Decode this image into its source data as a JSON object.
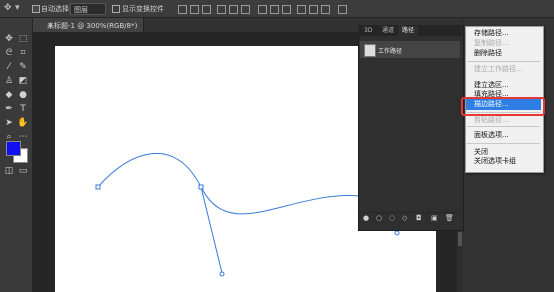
{
  "options_bar": {
    "auto_select_label": "自动选择:",
    "layer_select_value": "图层",
    "show_transform_label": "显示变换控件"
  },
  "document_tab": {
    "title": "未标题-1 @ 300%(RGB/8*) *"
  },
  "toolbar": {
    "tools": [
      "move-tool",
      "marquee-tool",
      "lasso-tool",
      "crop-tool",
      "eyedropper-tool",
      "brush-tool",
      "stamp-tool",
      "eraser-tool",
      "blur-tool",
      "dodge-tool",
      "pen-tool",
      "type-tool",
      "path-select-tool",
      "hand-tool",
      "zoom-tool",
      "edit-toolbar"
    ],
    "foreground_color": "#1010f0",
    "background_color": "#ffffff"
  },
  "panel": {
    "tabs": [
      "3D",
      "通道",
      "路径"
    ],
    "active_tab": "路径",
    "path_item": "工作路径",
    "footer_buttons": [
      "fill-path-icon",
      "stroke-path-icon",
      "load-selection-icon",
      "make-path-icon",
      "add-mask-icon",
      "new-path-icon",
      "delete-path-icon"
    ]
  },
  "context_menu": {
    "items": [
      {
        "label": "存储路径...",
        "enabled": true
      },
      {
        "label": "复制路径...",
        "enabled": false
      },
      {
        "label": "删除路径",
        "enabled": true
      },
      {
        "label": "建立工作路径...",
        "enabled": false
      },
      {
        "label": "建立选区...",
        "enabled": true
      },
      {
        "label": "填充路径...",
        "enabled": true
      },
      {
        "label": "描边路径...",
        "enabled": true,
        "highlighted": true
      },
      {
        "label": "剪贴路径...",
        "enabled": false
      },
      {
        "label": "面板选项...",
        "enabled": true
      },
      {
        "label": "关闭",
        "enabled": true
      },
      {
        "label": "关闭选项卡组",
        "enabled": true
      }
    ]
  },
  "colors": {
    "path_stroke": "#3a7bd5",
    "menu_highlight": "#2e7ee6",
    "annotation_box": "#e53935"
  }
}
